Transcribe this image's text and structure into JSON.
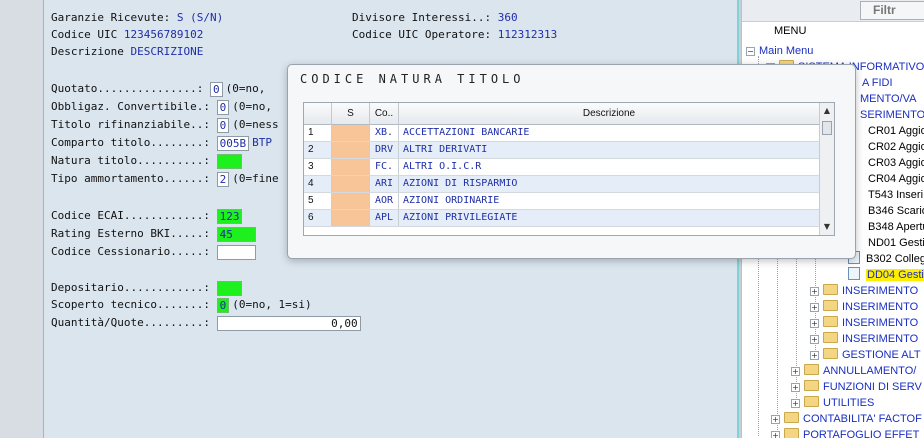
{
  "form": {
    "garanzie_label": "Garanzie Ricevute: ",
    "garanzie_value": "S (S/N)",
    "divisore_label": "Divisore Interessi..: ",
    "divisore_value": "360",
    "codice_uic_label": "Codice UIC  ",
    "codice_uic_value": "123456789102",
    "codice_uic_oper_label": "Codice UIC Operatore: ",
    "codice_uic_oper_value": "112312313",
    "descrizione_label": "Descrizione  ",
    "descrizione_value": "DESCRIZIONE",
    "quotato_label": "Quotato...............: ",
    "quotato_value": "0",
    "quotato_hint": "(0=no,",
    "obblig_label": "Obbligaz. Convertibile.: ",
    "obblig_value": "0",
    "obblig_hint": "(0=no,",
    "rifin_label": "Titolo rifinanziabile..: ",
    "rifin_value": "0",
    "rifin_hint": "(0=ness",
    "comparto_label": "Comparto titolo........: ",
    "comparto_value": "005B",
    "comparto_hint": "BTP",
    "natura_label": "Natura titolo..........: ",
    "natura_value": "",
    "ammort_label": "Tipo ammortamento......: ",
    "ammort_value": "2",
    "ammort_hint": "(0=fine",
    "ecai_label": "Codice ECAI............: ",
    "ecai_value": "123",
    "rating_label": "Rating Esterno BKI.....: ",
    "rating_value": "45",
    "cessionario_label": "Codice Cessionario.....: ",
    "cessionario_value": "",
    "depositario_label": "Depositario............: ",
    "depositario_value": "",
    "scoperto_label": "Scoperto tecnico.......: ",
    "scoperto_value": "0",
    "scoperto_hint": "(0=no, 1=si)",
    "quantita_label": "Quantità/Quote.........: ",
    "quantita_value": "0,00"
  },
  "modal": {
    "title": "CODICE NATURA TITOLO",
    "columns": {
      "s": "S",
      "co": "Co..",
      "desc": "Descrizione"
    },
    "rows": [
      {
        "num": "1",
        "co": "XB.",
        "desc": "ACCETTAZIONI BANCARIE"
      },
      {
        "num": "2",
        "co": "DRV",
        "desc": "ALTRI DERIVATI"
      },
      {
        "num": "3",
        "co": "FC.",
        "desc": "ALTRI O.I.C.R"
      },
      {
        "num": "4",
        "co": "ARI",
        "desc": "AZIONI DI RISPARMIO"
      },
      {
        "num": "5",
        "co": "AOR",
        "desc": "AZIONI ORDINARIE"
      },
      {
        "num": "6",
        "co": "APL",
        "desc": "AZIONI PRIVILEGIATE"
      }
    ]
  },
  "tree": {
    "filter_label": "Filtr",
    "menu_header": "MENU",
    "items": {
      "main_menu": "Main Menu",
      "sistema": "SISTEMA INFORMATIVO F",
      "fidi": "A FIDI",
      "mento": "MENTO/VA",
      "inserimento_top": "SERIMENTO",
      "cr01": "CR01 Aggio",
      "cr02": "CR02 Aggio",
      "cr03": "CR03 Aggio",
      "cr04": "CR04 Aggio",
      "t543": "T543 Inseri",
      "b346": "B346 Scario",
      "b348": "B348 Apertu",
      "nd01": "ND01 Gesti",
      "b302": "B302 Colleg",
      "dd04": "DD04 Gesti",
      "ins1": "INSERIMENTO",
      "ins2": "INSERIMENTO",
      "ins3": "INSERIMENTO",
      "ins4": "INSERIMENTO",
      "gestione_alt": "GESTIONE ALT",
      "annullamento": "ANNULLAMENTO/",
      "funzioni": "FUNZIONI DI SERV",
      "utilities": "UTILITIES",
      "contabilita": "CONTABILITA' FACTOF",
      "portafoglio": "PORTAFOGLIO EFFET"
    }
  },
  "colors": {
    "form_bg": "#dbe5ee",
    "field_green": "#1ef01e",
    "value_blue": "#1f2ea8",
    "highlight_yellow": "#ffee00",
    "s_column_orange": "#f7c598"
  }
}
